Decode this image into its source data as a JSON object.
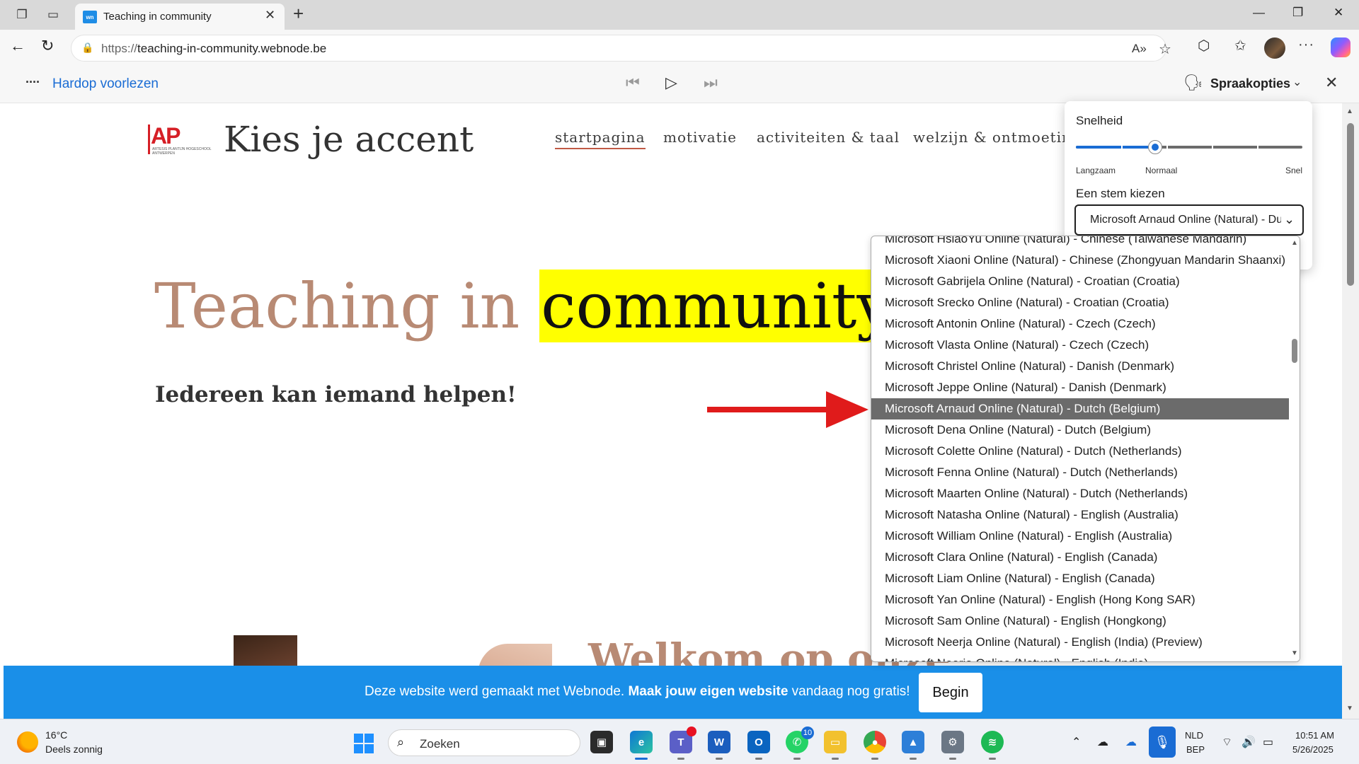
{
  "browser": {
    "tab_title": "Teaching in community",
    "tab_favicon_text": "wn",
    "url_prefix": "https://",
    "url_host": "teaching-in-community.webnode.be"
  },
  "read_aloud": {
    "title": "Hardop voorlezen",
    "voice_options_label": "Spraakopties"
  },
  "speed_panel": {
    "speed_label": "Snelheid",
    "speed_level_fraction": 0.35,
    "slow_label": "Langzaam",
    "normal_label": "Normaal",
    "fast_label": "Snel",
    "voice_label": "Een stem kiezen",
    "selected_voice": "Microsoft Arnaud Online (Natural) - Dutch (Belgium)"
  },
  "voice_list": [
    "Microsoft HsiaoYu Online (Natural) - Chinese (Taiwanese Mandarin)",
    "Microsoft Xiaoni Online (Natural) - Chinese (Zhongyuan Mandarin Shaanxi)",
    "Microsoft Gabrijela Online (Natural) - Croatian (Croatia)",
    "Microsoft Srecko Online (Natural) - Croatian (Croatia)",
    "Microsoft Antonin Online (Natural) - Czech (Czech)",
    "Microsoft Vlasta Online (Natural) - Czech (Czech)",
    "Microsoft Christel Online (Natural) - Danish (Denmark)",
    "Microsoft Jeppe Online (Natural) - Danish (Denmark)",
    "Microsoft Arnaud Online (Natural) - Dutch (Belgium)",
    "Microsoft Dena Online (Natural) - Dutch (Belgium)",
    "Microsoft Colette Online (Natural) - Dutch (Netherlands)",
    "Microsoft Fenna Online (Natural) - Dutch (Netherlands)",
    "Microsoft Maarten Online (Natural) - Dutch (Netherlands)",
    "Microsoft Natasha Online (Natural) - English (Australia)",
    "Microsoft William Online (Natural) - English (Australia)",
    "Microsoft Clara Online (Natural) - English (Canada)",
    "Microsoft Liam Online (Natural) - English (Canada)",
    "Microsoft Yan Online (Natural) - English (Hong Kong SAR)",
    "Microsoft Sam Online (Natural) - English (Hongkong)",
    "Microsoft Neerja Online (Natural) - English (India) (Preview)",
    "Microsoft Neerja Online (Natural) - English (India)"
  ],
  "site": {
    "logo_text": "AP",
    "logo_subtext": "ARTESIS PLANTIJN HOGESCHOOL ANTWERPEN",
    "title": "Kies je accent",
    "menu": [
      "startpagina",
      "motivatie",
      "activiteiten & taal",
      "welzijn & ontmoeting"
    ],
    "hero_title_plain": "Teaching in ",
    "hero_title_highlight": "community",
    "hero_subtitle": "Iedereen kan iemand helpen!",
    "welcome_partial": "Welkom op onze"
  },
  "banner": {
    "text_before": "Deze website werd gemaakt met Webnode. ",
    "text_strong": "Maak jouw eigen website",
    "text_after": " vandaag nog gratis!",
    "button": "Begin"
  },
  "taskbar": {
    "weather_temp": "16°C",
    "weather_desc": "Deels zonnig",
    "search_label": "Zoeken",
    "teams_badge": "",
    "whatsapp_badge": "10",
    "lang_line1": "NLD",
    "lang_line2": "BEP",
    "time": "10:51 AM",
    "date": "5/26/2025"
  },
  "colors": {
    "accent": "#1a6cd4",
    "highlight": "#ffff00",
    "banner": "#1a8fe8",
    "arrow": "#e01b1b",
    "hero_text": "#b88a74"
  }
}
